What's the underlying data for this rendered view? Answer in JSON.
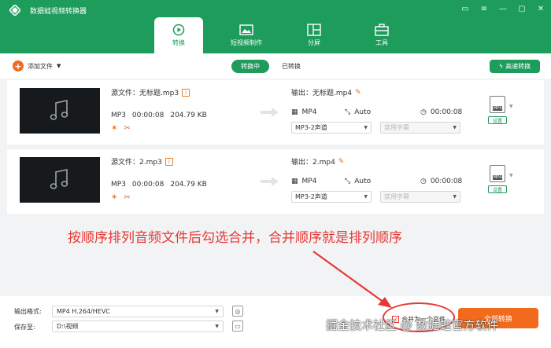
{
  "app": {
    "title": "数据蛙视频转换器"
  },
  "window_controls": [
    "chat-icon",
    "menu-icon",
    "minimize-icon",
    "maximize-icon",
    "close-icon"
  ],
  "nav": [
    {
      "label": "转换",
      "icon": "convert-icon",
      "active": true
    },
    {
      "label": "短视频制作",
      "icon": "video-make-icon",
      "active": false
    },
    {
      "label": "分屏",
      "icon": "split-screen-icon",
      "active": false
    },
    {
      "label": "工具",
      "icon": "toolbox-icon",
      "active": false
    }
  ],
  "toolbar": {
    "add_file": "添加文件",
    "tab_converting": "转换中",
    "tab_converted": "已转换",
    "fast_convert": "高速转换"
  },
  "files": [
    {
      "source_label": "源文件：无标题.mp3",
      "format": "MP3",
      "duration": "00:00:08",
      "size": "204.79 KB",
      "output_label": "输出：无标题.mp4",
      "out_format": "MP4",
      "out_resolution": "Auto",
      "out_duration": "00:00:08",
      "audio_track": "MP3-2声道",
      "subtitle": "禁用字幕",
      "fmt_tag": "MP4",
      "settings": "设置"
    },
    {
      "source_label": "源文件：2.mp3",
      "format": "MP3",
      "duration": "00:00:08",
      "size": "204.79 KB",
      "output_label": "输出：2.mp4",
      "out_format": "MP4",
      "out_resolution": "Auto",
      "out_duration": "00:00:08",
      "audio_track": "MP3-2声道",
      "subtitle": "禁用字幕",
      "fmt_tag": "MP4",
      "settings": "设置"
    }
  ],
  "annotation": "按顺序排列音频文件后勾选合并，合并顺序就是排列顺序",
  "bottom": {
    "output_format_label": "输出格式:",
    "output_format_value": "MP4 H.264/HEVC",
    "save_to_label": "保存至:",
    "save_to_value": "D:\\视频",
    "merge_label": "合并为一个文件",
    "merge_checked": true,
    "convert_all": "全部转换"
  },
  "watermark": "掘金技术社区 @ 数据蛙官方软件",
  "colors": {
    "brand": "#1e9c5c",
    "accent": "#f26a1b",
    "annotation": "#e53935"
  }
}
